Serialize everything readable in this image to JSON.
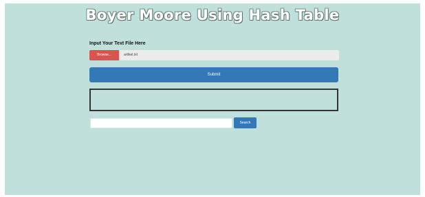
{
  "page": {
    "title": "Boyer Moore Using Hash Table"
  },
  "upload": {
    "label": "Input Your Text File Here",
    "browse_label": "Browse...",
    "file_name": "artikel.txt"
  },
  "actions": {
    "submit_label": "Submit",
    "search_label": "Search"
  },
  "search": {
    "value": ""
  },
  "output": {
    "text": ""
  },
  "colors": {
    "background": "#bfe0db",
    "primary_button": "#3479b7",
    "browse_button": "#d9534f"
  }
}
